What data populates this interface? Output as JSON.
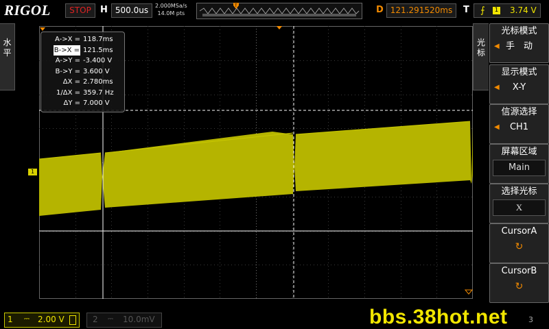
{
  "top": {
    "brand": "RIGOL",
    "run_state": "STOP",
    "horizontal_label": "H",
    "timebase": "500.0us",
    "sample_rate": "2.000MSa/s",
    "memory_depth": "14.0M pts",
    "delay_label": "D",
    "delay": "121.291520ms",
    "trigger_label": "T",
    "trigger_channel": "1",
    "trigger_level": "3.74 V"
  },
  "left_tab": {
    "chars": [
      "水",
      "平"
    ]
  },
  "cursor_readout": [
    {
      "label": "A->X =",
      "value": "118.7ms"
    },
    {
      "label": "B->X =",
      "value": "121.5ms",
      "selected": true
    },
    {
      "label": "A->Y =",
      "value": "-3.400 V"
    },
    {
      "label": "B->Y =",
      "value": "3.600 V"
    },
    {
      "label": "ΔX =",
      "value": "2.780ms"
    },
    {
      "label": "1/ΔX =",
      "value": "359.7 Hz"
    },
    {
      "label": "ΔY =",
      "value": "7.000 V"
    }
  ],
  "ch1_marker": "1",
  "right_tab": {
    "chars": [
      "光",
      "标"
    ]
  },
  "menu": [
    {
      "title": "光标模式",
      "value": "手　动"
    },
    {
      "title": "显示模式",
      "value": "X-Y"
    },
    {
      "title": "信源选择",
      "value": "CH1"
    },
    {
      "title": "屏幕区域",
      "value": "Main",
      "boxed": true
    },
    {
      "title": "选择光标",
      "value": "X",
      "boxed": true
    },
    {
      "title": "CursorA",
      "value": "↻"
    },
    {
      "title": "CursorB",
      "value": "↻"
    }
  ],
  "bottom": {
    "ch1_num": "1",
    "ch1_scale": "2.00 V",
    "ch2_num": "2",
    "ch2_scale": "10.0mV",
    "time": "3"
  },
  "watermark": "bbs.38hot.net",
  "colors": {
    "trace": "#b5b400",
    "accent": "#f28a00",
    "stop": "#dd2222"
  }
}
